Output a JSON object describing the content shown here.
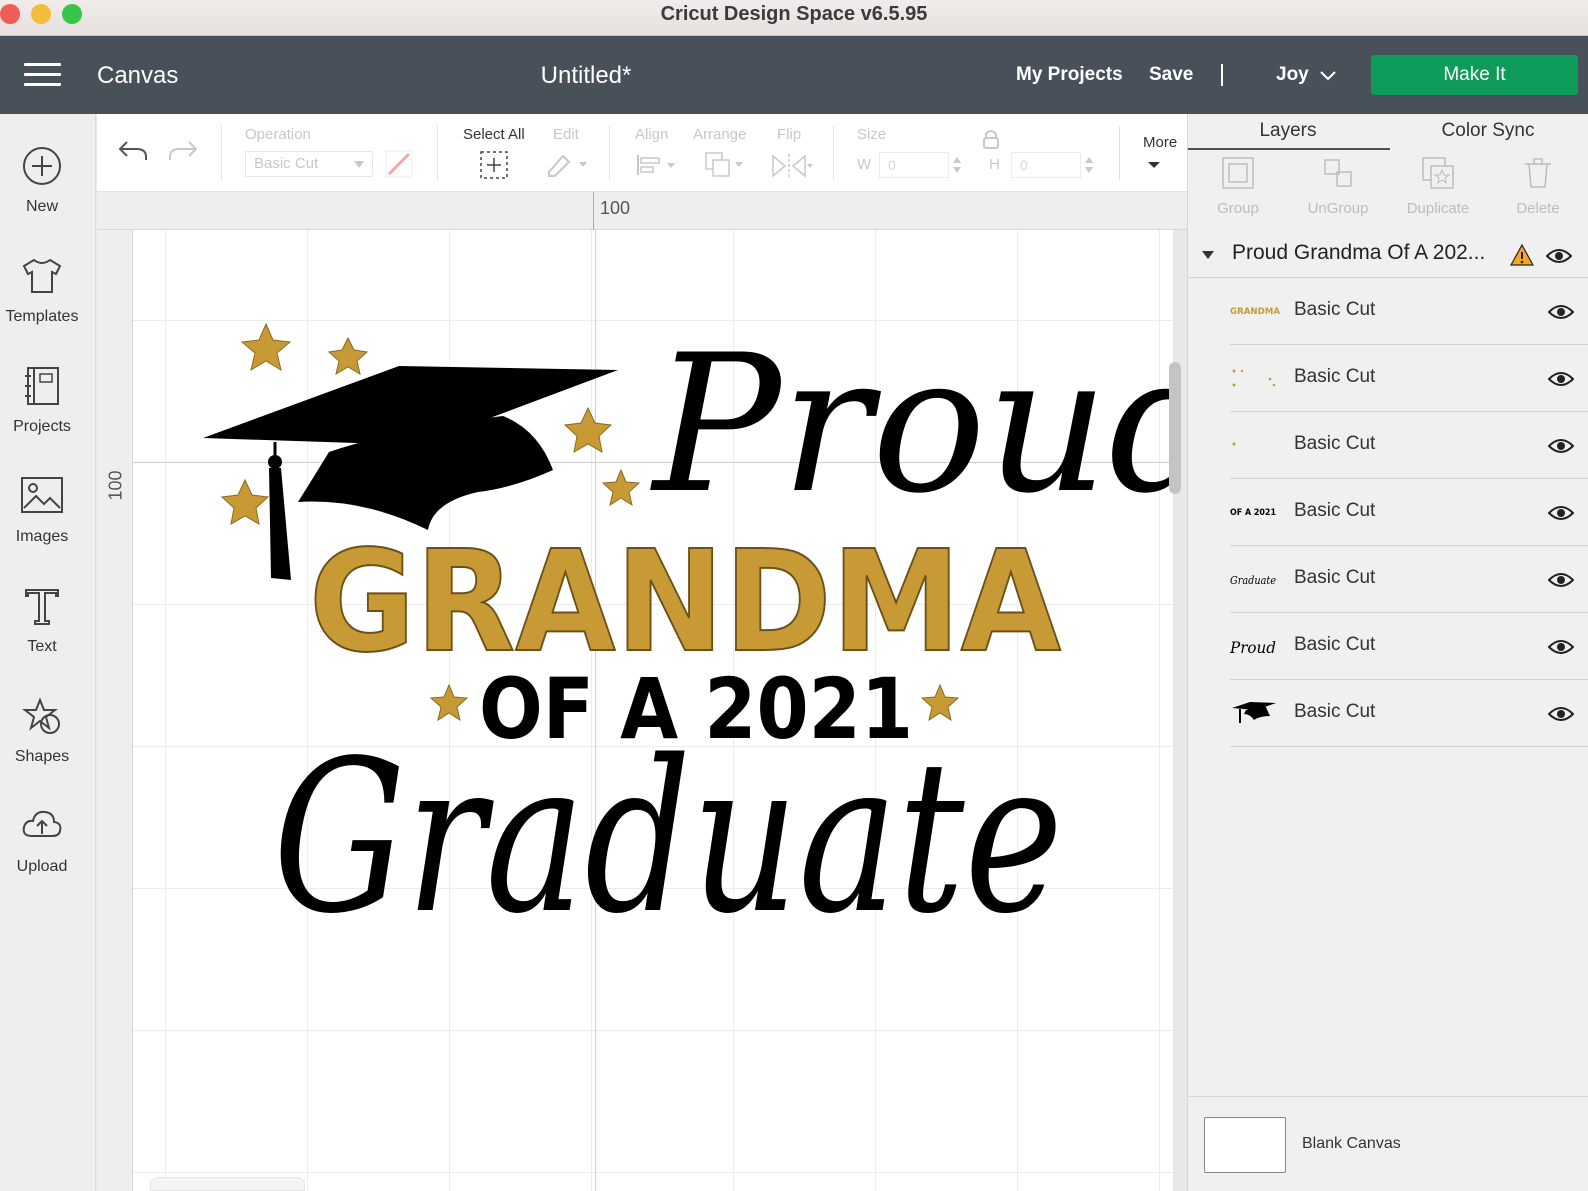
{
  "window": {
    "title": "Cricut Design Space  v6.5.95"
  },
  "header": {
    "section": "Canvas",
    "document_title": "Untitled*",
    "my_projects": "My Projects",
    "save": "Save",
    "separator": "|",
    "user": "Joy",
    "make_it": "Make It"
  },
  "sidebar": {
    "items": [
      {
        "label": "New",
        "icon": "plus-circle-icon"
      },
      {
        "label": "Templates",
        "icon": "tshirt-icon"
      },
      {
        "label": "Projects",
        "icon": "notebook-icon"
      },
      {
        "label": "Images",
        "icon": "image-icon"
      },
      {
        "label": "Text",
        "icon": "text-t-icon"
      },
      {
        "label": "Shapes",
        "icon": "shapes-icon"
      },
      {
        "label": "Upload",
        "icon": "cloud-upload-icon"
      }
    ]
  },
  "toolbar": {
    "operation_label": "Operation",
    "operation_value": "Basic Cut",
    "select_all": "Select All",
    "edit": "Edit",
    "align": "Align",
    "arrange": "Arrange",
    "flip": "Flip",
    "size": "Size",
    "w_label": "W",
    "w_value": "0",
    "h_label": "H",
    "h_value": "0",
    "more": "More"
  },
  "rulers": {
    "top_label": "100",
    "left_label": "100"
  },
  "design": {
    "word_proud": "Proud",
    "word_grandma": "GRANDMA",
    "word_of": "OF A 2021",
    "word_graduate": "Graduate",
    "gold": "#c89a35",
    "black": "#000000"
  },
  "panel": {
    "tabs": [
      "Layers",
      "Color Sync"
    ],
    "tools": [
      "Group",
      "UnGroup",
      "Duplicate",
      "Delete"
    ],
    "group_name": "Proud Grandma Of A 202...",
    "layers": [
      {
        "name": "Basic Cut",
        "thumb_text": "GRANDMA"
      },
      {
        "name": "Basic Cut",
        "thumb_text": ""
      },
      {
        "name": "Basic Cut",
        "thumb_text": ""
      },
      {
        "name": "Basic Cut",
        "thumb_text": "OF A 2021"
      },
      {
        "name": "Basic Cut",
        "thumb_text": "Graduate"
      },
      {
        "name": "Basic Cut",
        "thumb_text": "Proud"
      },
      {
        "name": "Basic Cut",
        "thumb_text": ""
      }
    ],
    "blank_canvas": "Blank Canvas"
  }
}
